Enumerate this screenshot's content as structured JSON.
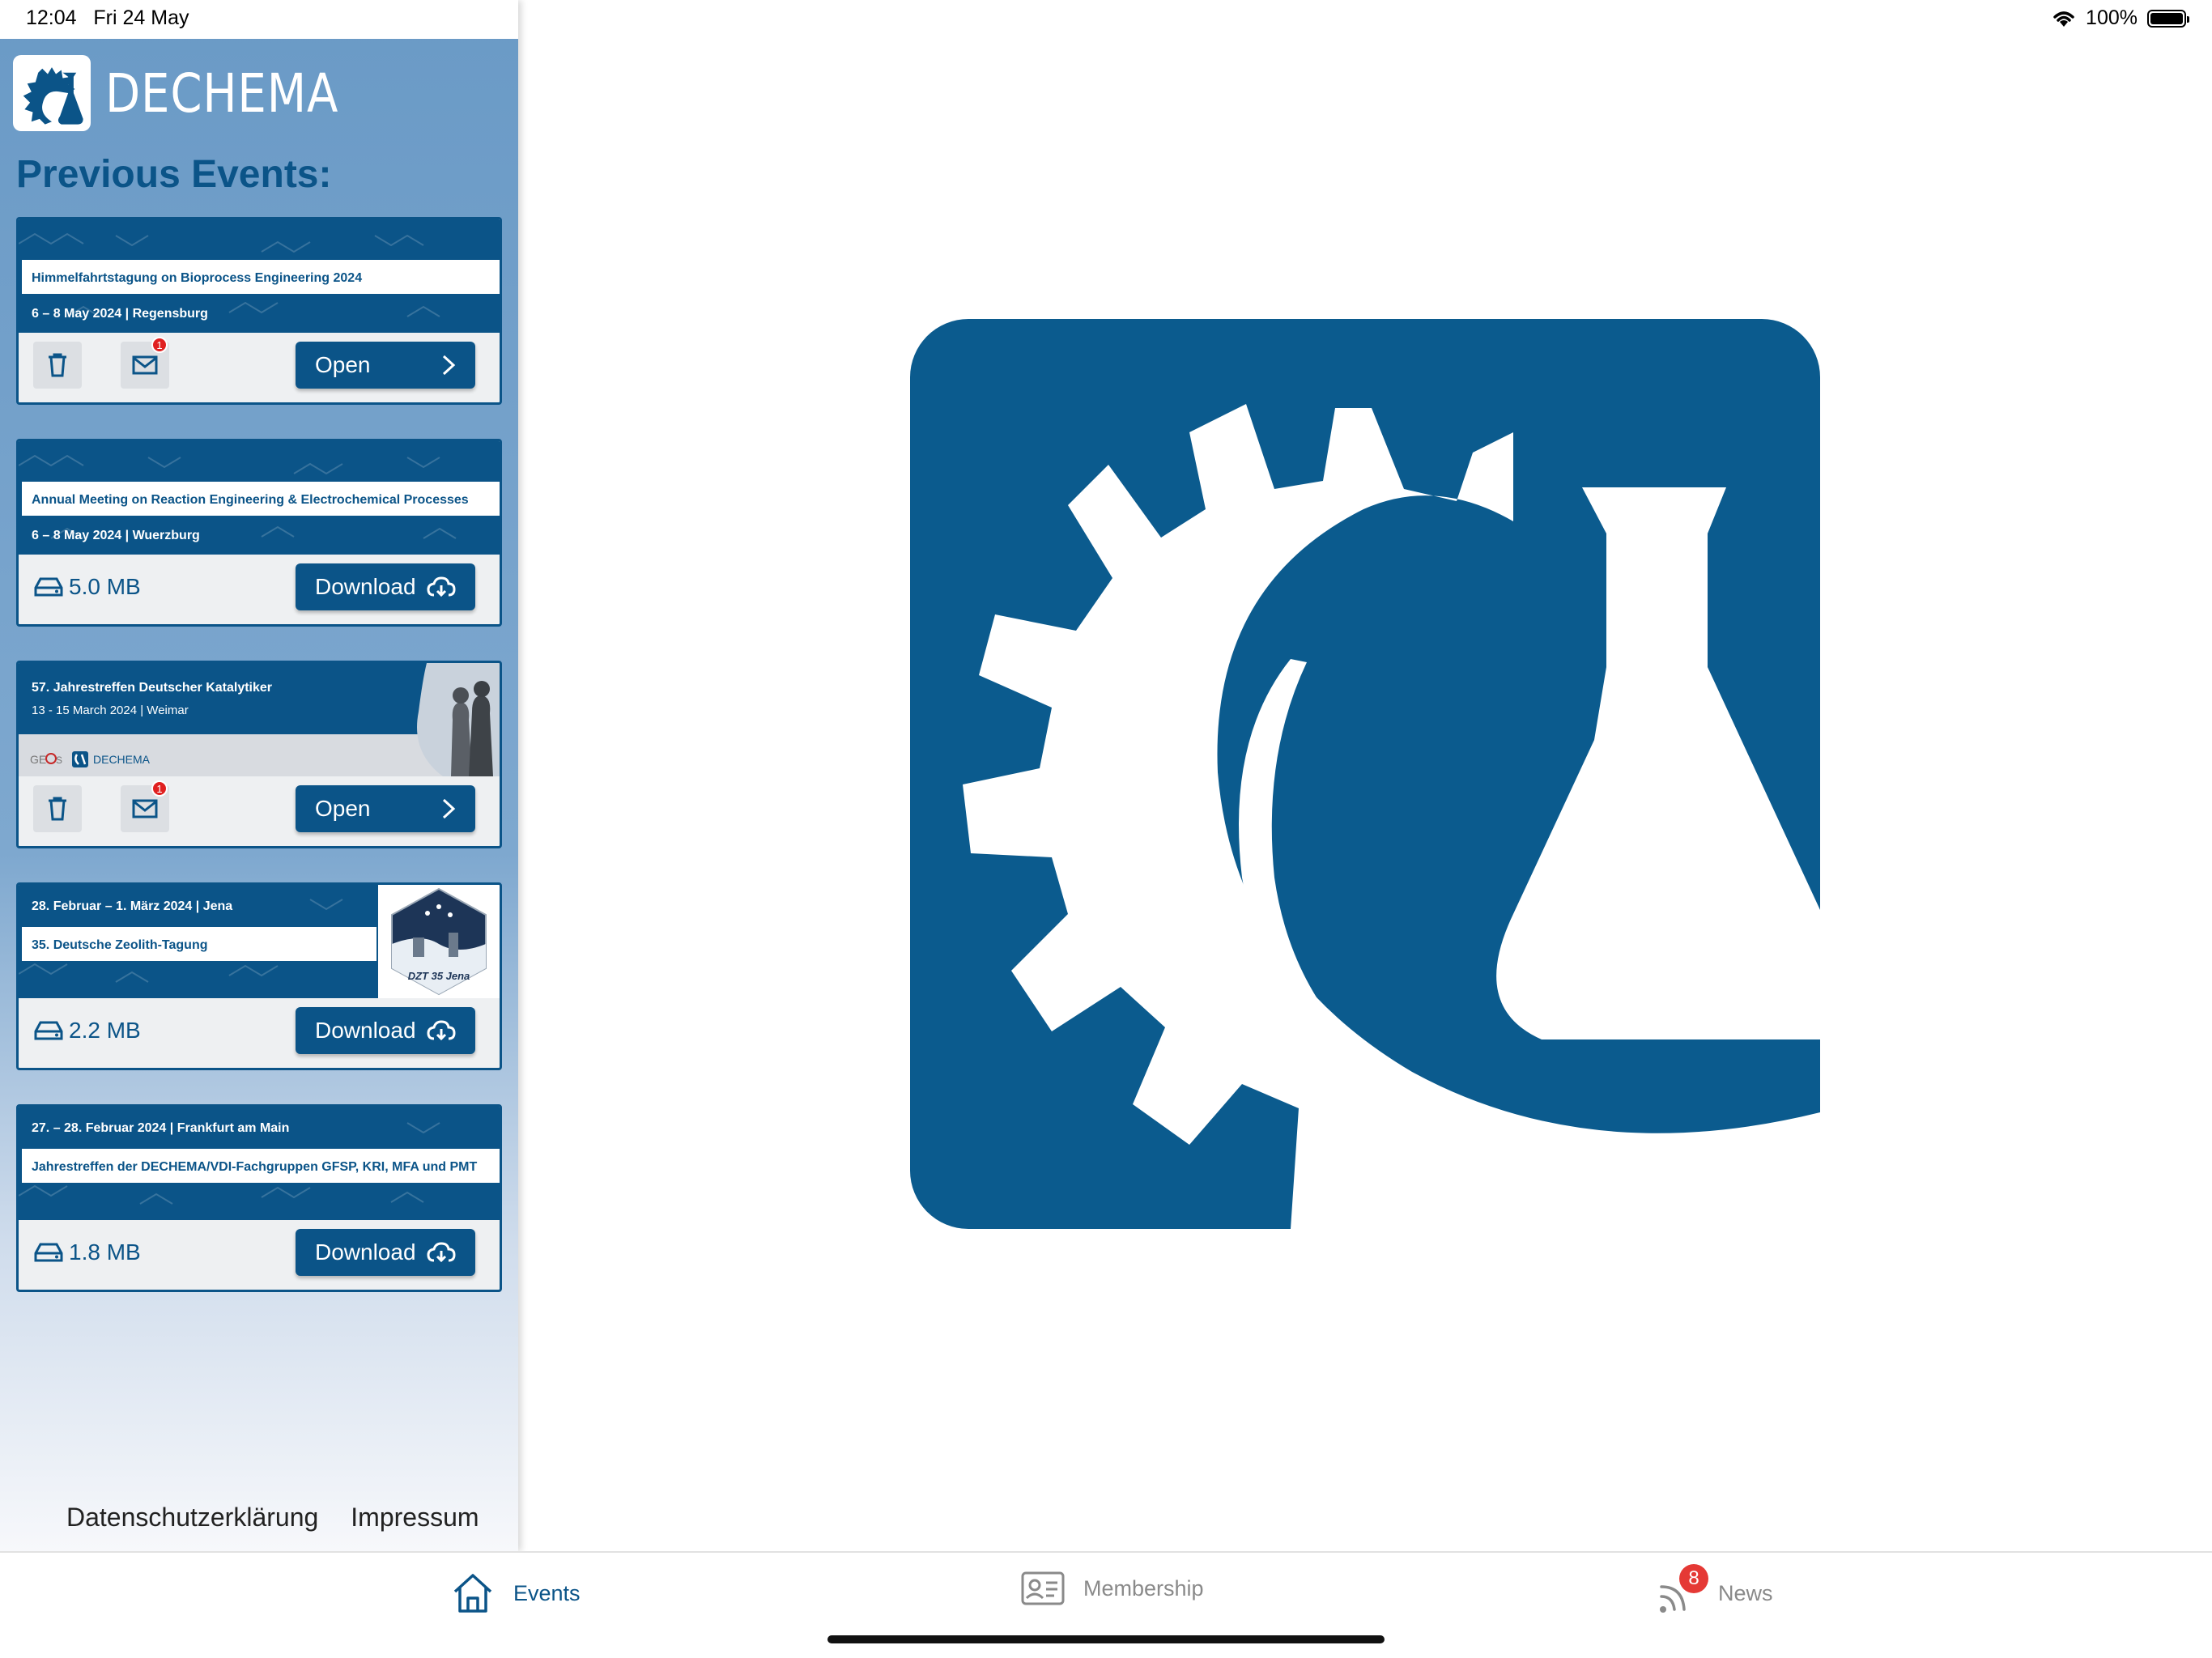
{
  "status_bar": {
    "time": "12:04",
    "date": "Fri 24 May",
    "battery_text": "100%",
    "battery_level": 1.0
  },
  "brand": {
    "name": "DECHEMA"
  },
  "section_title": "Previous Events:",
  "events": [
    {
      "title": "Himmelfahrtstagung on Bioprocess Engineering 2024",
      "details": "6 – 8 May 2024 | Regensburg",
      "action_label": "Open",
      "mail_badge": "1"
    },
    {
      "title": "Annual Meeting on Reaction Engineering & Electrochemical Processes",
      "details": "6 – 8 May 2024 | Wuerzburg",
      "action_label": "Download",
      "size": "5.0 MB"
    },
    {
      "title": "57. Jahrestreffen Deutscher Katalytiker",
      "details": "13 - 15 March 2024 | Weimar",
      "org_label": "DECHEMA",
      "action_label": "Open",
      "mail_badge": "1"
    },
    {
      "title": "28. Februar – 1. März 2024 | Jena",
      "details": "35. Deutsche Zeolith-Tagung",
      "badge_text": "DZT 35 Jena",
      "action_label": "Download",
      "size": "2.2 MB"
    },
    {
      "title": "27. – 28.  Februar 2024 | Frankfurt am Main",
      "details": "Jahrestreffen der DECHEMA/VDI-Fachgruppen GFSP, KRI, MFA und PMT",
      "action_label": "Download",
      "size": "1.8 MB"
    }
  ],
  "footer_links": {
    "privacy": "Datenschutzerklärung",
    "imprint": "Impressum"
  },
  "tabs": {
    "events": "Events",
    "membership": "Membership",
    "news": "News",
    "news_badge": "8"
  },
  "colors": {
    "brand_blue": "#0b5488",
    "sidebar_blue": "#6a9ac6",
    "badge_red": "#e02020"
  }
}
